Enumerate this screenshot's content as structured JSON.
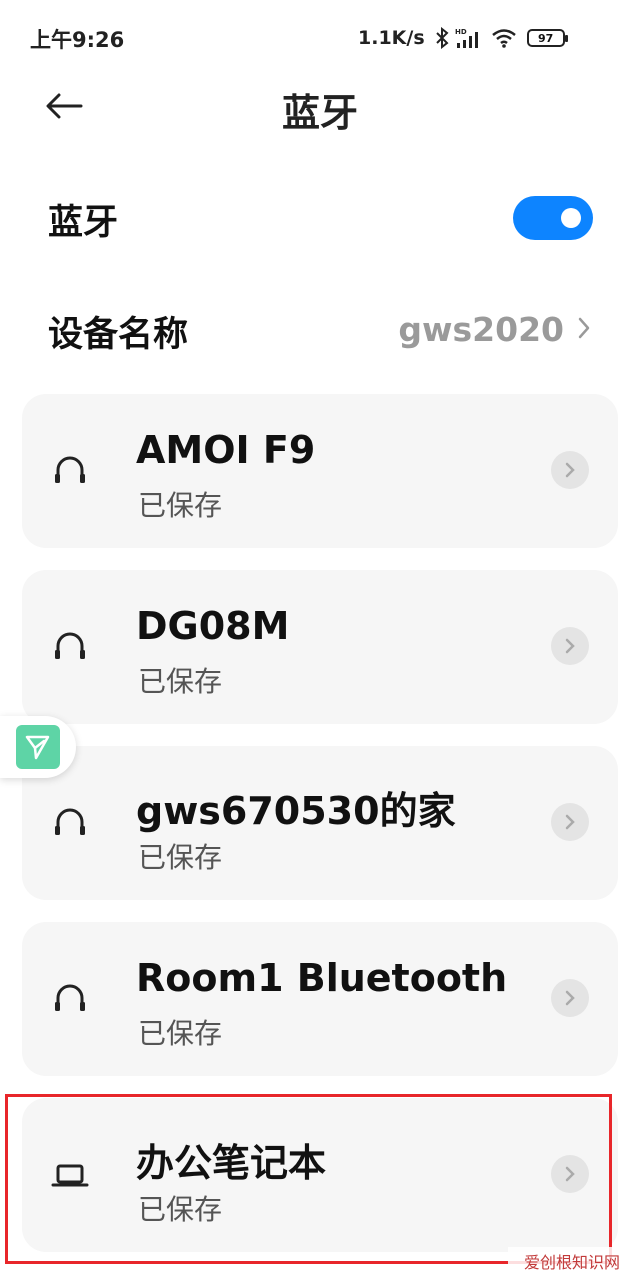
{
  "status_bar": {
    "time": "上午9:26",
    "speed": "1.1K/s",
    "battery": "97",
    "icons": [
      "bluetooth-icon",
      "hd-signal-icon",
      "wifi-icon",
      "battery-icon"
    ]
  },
  "header": {
    "back_icon": "arrow-left-icon",
    "title": "蓝牙"
  },
  "bluetooth_toggle": {
    "label": "蓝牙",
    "enabled": true,
    "accent_color": "#0d84ff"
  },
  "device_name": {
    "label": "设备名称",
    "value": "gws2020"
  },
  "devices": [
    {
      "name": "AMOI F9",
      "status": "已保存",
      "icon": "headphones-icon"
    },
    {
      "name": "DG08M",
      "status": "已保存",
      "icon": "headphones-icon"
    },
    {
      "name": "gws670530的家",
      "status": "已保存",
      "icon": "headphones-icon"
    },
    {
      "name": "Room1 Bluetooth",
      "status": "已保存",
      "icon": "headphones-icon"
    },
    {
      "name": "办公笔记本",
      "status": "已保存",
      "icon": "laptop-icon"
    }
  ],
  "highlight_color": "#e8262a",
  "watermark": "爱创根知识网"
}
